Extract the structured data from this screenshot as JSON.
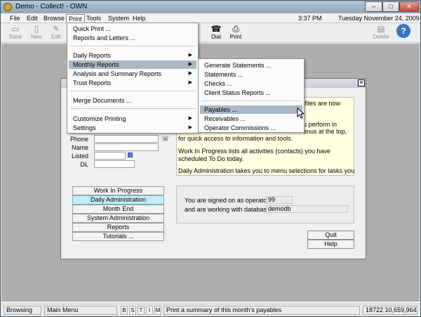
{
  "window": {
    "title": "Demo - Collect! - OWN",
    "min": "–",
    "max": "□",
    "close": "✕"
  },
  "menubar": {
    "items": [
      "File",
      "Edit",
      "Browse",
      "Print",
      "Tools",
      "System",
      "Help"
    ],
    "clock": "3:37 PM",
    "date": "Tuesday  November 24, 2009"
  },
  "toolbar": {
    "left": [
      "Save",
      "New",
      "Edit"
    ],
    "right": [
      "Dial",
      "Print",
      "Delete"
    ]
  },
  "print_menu": {
    "items": [
      {
        "label": "Quick Print ...",
        "submenu": false
      },
      {
        "label": "Reports and Letters ...",
        "submenu": false
      },
      {
        "label": "Daily Reports",
        "submenu": true
      },
      {
        "label": "Monthly Reports",
        "submenu": true
      },
      {
        "label": "Analysis and Summary Reports",
        "submenu": true
      },
      {
        "label": "Trust Reports",
        "submenu": true
      },
      {
        "label": "Merge Documents ...",
        "submenu": false
      },
      {
        "label": "Customize Printing",
        "submenu": true
      },
      {
        "label": "Settings",
        "submenu": true
      }
    ]
  },
  "monthly_menu": {
    "items": [
      "Generate Statements ...",
      "Statements ...",
      "Checks ...",
      "Client Status Reports ...",
      "Payables ...",
      "Receivables ...",
      "Operator Commissions ..."
    ]
  },
  "main": {
    "fields": [
      {
        "label": "Phone"
      },
      {
        "label": "Name"
      },
      {
        "label": "Listed"
      },
      {
        "label": "DL"
      }
    ],
    "info": {
      "line1": "e files are now",
      "line2": "u perform in",
      "line3": "enus at the top,",
      "line4": "for quick access to information and tools.",
      "p2": "Work In Progress lists all activities (contacts) you have scheduled To Do today.",
      "p3": "Daily Administration takes you to menu selections for tasks you"
    },
    "nav_buttons": [
      "Work In Progress",
      "Daily Administration",
      "Month End",
      "System Administration",
      "Reports",
      "Tutorials ..."
    ],
    "operator": {
      "label1": "You are signed on as operator",
      "value1": "99",
      "label2": "and are working with database",
      "value2": "demodb"
    },
    "quit": "Quit",
    "help": "Help"
  },
  "statusbar": {
    "mode": "Browsing",
    "screen": "Main Menu",
    "flags": [
      "B",
      "S",
      "T",
      "I",
      "M"
    ],
    "message": "Print a summary of this month's payables",
    "coords": "18722 10,659,964"
  }
}
